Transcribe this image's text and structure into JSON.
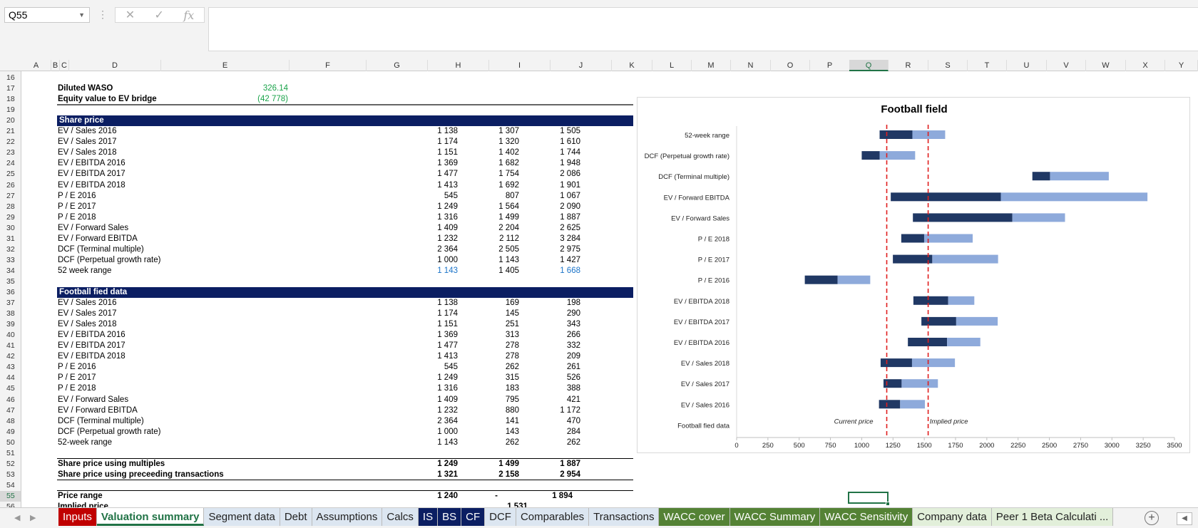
{
  "name_box": "Q55",
  "formula_bar": {
    "fx_label": "fx",
    "cancel_icon": "✕",
    "enter_icon": "✓",
    "value": ""
  },
  "columns": [
    "A",
    "B",
    "C",
    "D",
    "E",
    "F",
    "G",
    "H",
    "I",
    "J",
    "K",
    "L",
    "M",
    "N",
    "O",
    "P",
    "Q",
    "R",
    "S",
    "T",
    "U",
    "V",
    "W",
    "X",
    "Y"
  ],
  "selected_column": "Q",
  "rows": [
    16,
    17,
    18,
    19,
    20,
    21,
    22,
    23,
    24,
    25,
    26,
    27,
    28,
    29,
    30,
    31,
    32,
    33,
    34,
    35,
    36,
    37,
    38,
    39,
    40,
    41,
    42,
    43,
    44,
    45,
    46,
    47,
    48,
    49,
    50,
    51,
    52,
    53,
    54,
    55,
    56
  ],
  "selected_row": 55,
  "top": {
    "diluted_waso_label": "Diluted WASO",
    "diluted_waso_value": "326.14",
    "bridge_label": "Equity value to EV bridge",
    "bridge_value": "(42 778)"
  },
  "share_price": {
    "header": "Share price",
    "rows": [
      {
        "label": "EV / Sales 2016",
        "h": "1 138",
        "i": "1 307",
        "j": "1 505"
      },
      {
        "label": "EV / Sales 2017",
        "h": "1 174",
        "i": "1 320",
        "j": "1 610"
      },
      {
        "label": "EV / Sales 2018",
        "h": "1 151",
        "i": "1 402",
        "j": "1 744"
      },
      {
        "label": "EV / EBITDA 2016",
        "h": "1 369",
        "i": "1 682",
        "j": "1 948"
      },
      {
        "label": "EV / EBITDA 2017",
        "h": "1 477",
        "i": "1 754",
        "j": "2 086"
      },
      {
        "label": "EV / EBITDA 2018",
        "h": "1 413",
        "i": "1 692",
        "j": "1 901"
      },
      {
        "label": "P / E 2016",
        "h": "545",
        "i": "807",
        "j": "1 067"
      },
      {
        "label": "P / E 2017",
        "h": "1 249",
        "i": "1 564",
        "j": "2 090"
      },
      {
        "label": "P / E 2018",
        "h": "1 316",
        "i": "1 499",
        "j": "1 887"
      },
      {
        "label": "EV / Forward Sales",
        "h": "1 409",
        "i": "2 204",
        "j": "2 625"
      },
      {
        "label": "EV / Forward EBITDA",
        "h": "1 232",
        "i": "2 112",
        "j": "3 284"
      },
      {
        "label": "DCF (Terminal multiple)",
        "h": "2 364",
        "i": "2 505",
        "j": "2 975"
      },
      {
        "label": "DCF (Perpetual growth rate)",
        "h": "1 000",
        "i": "1 143",
        "j": "1 427"
      },
      {
        "label": "52 week range",
        "h": "1 143",
        "i": "1 405",
        "j": "1 668"
      }
    ]
  },
  "football_data": {
    "header": "Football fied data",
    "rows": [
      {
        "label": "EV / Sales 2016",
        "h": "1 138",
        "i": "169",
        "j": "198"
      },
      {
        "label": "EV / Sales 2017",
        "h": "1 174",
        "i": "145",
        "j": "290"
      },
      {
        "label": "EV / Sales 2018",
        "h": "1 151",
        "i": "251",
        "j": "343"
      },
      {
        "label": "EV / EBITDA 2016",
        "h": "1 369",
        "i": "313",
        "j": "266"
      },
      {
        "label": "EV / EBITDA 2017",
        "h": "1 477",
        "i": "278",
        "j": "332"
      },
      {
        "label": "EV / EBITDA 2018",
        "h": "1 413",
        "i": "278",
        "j": "209"
      },
      {
        "label": "P / E 2016",
        "h": "545",
        "i": "262",
        "j": "261"
      },
      {
        "label": "P / E 2017",
        "h": "1 249",
        "i": "315",
        "j": "526"
      },
      {
        "label": "P / E 2018",
        "h": "1 316",
        "i": "183",
        "j": "388"
      },
      {
        "label": "EV / Forward Sales",
        "h": "1 409",
        "i": "795",
        "j": "421"
      },
      {
        "label": "EV / Forward EBITDA",
        "h": "1 232",
        "i": "880",
        "j": "1 172"
      },
      {
        "label": "DCF (Terminal multiple)",
        "h": "2 364",
        "i": "141",
        "j": "470"
      },
      {
        "label": "DCF (Perpetual growth rate)",
        "h": "1 000",
        "i": "143",
        "j": "284"
      },
      {
        "label": "52-week range",
        "h": "1 143",
        "i": "262",
        "j": "262"
      }
    ]
  },
  "summary": {
    "multiples_label": "Share price using multiples",
    "multiples": {
      "h": "1 249",
      "i": "1 499",
      "j": "1 887"
    },
    "transactions_label": "Share price using preceeding transactions",
    "transactions": {
      "h": "1 321",
      "i": "2 158",
      "j": "2 954"
    },
    "price_range_label": "Price range",
    "price_range_low": "1 240",
    "price_range_sep": "-",
    "price_range_high": "1 894",
    "implied_price_label": "Implied price",
    "implied_price_value": "1 531"
  },
  "chart_data": {
    "type": "bar",
    "orientation": "horizontal-stacked",
    "title": "Football field",
    "categories": [
      "52-week range",
      "DCF (Perpetual growth rate)",
      "DCF (Terminal multiple)",
      "EV / Forward EBITDA",
      "EV / Forward Sales",
      "P / E 2018",
      "P / E 2017",
      "P / E 2016",
      "EV / EBITDA 2018",
      "EV / EBITDA 2017",
      "EV / EBITDA 2016",
      "EV / Sales 2018",
      "EV / Sales 2017",
      "EV / Sales 2016",
      "Football fied data"
    ],
    "series": [
      {
        "values": [
          1143,
          1000,
          2364,
          1232,
          1409,
          1316,
          1249,
          545,
          1413,
          1477,
          1369,
          1151,
          1174,
          1138,
          null
        ]
      },
      {
        "values": [
          262,
          143,
          141,
          880,
          795,
          183,
          315,
          262,
          278,
          278,
          313,
          251,
          145,
          169,
          null
        ]
      },
      {
        "values": [
          262,
          284,
          470,
          1172,
          421,
          388,
          526,
          261,
          209,
          332,
          266,
          343,
          290,
          198,
          null
        ]
      }
    ],
    "reference_lines": [
      {
        "label": "Current price",
        "value": 1200
      },
      {
        "label": "Implied price",
        "value": 1531
      }
    ],
    "xlim": [
      0,
      3500
    ],
    "xticks": [
      "0",
      "250",
      "500",
      "750",
      "1000",
      "1250",
      "1500",
      "1750",
      "2000",
      "2250",
      "2500",
      "2750",
      "3000",
      "3250",
      "3500"
    ],
    "colors": {
      "base": "none",
      "low": "#203864",
      "high": "#8eaadb",
      "reference": "#e01e1e"
    }
  },
  "sheet_tabs": [
    {
      "label": "Inputs",
      "bg": "#c00000",
      "fg": "#ffffff"
    },
    {
      "label": "Valuation summary",
      "bg": "#ffffff",
      "fg": "#217346",
      "active": true
    },
    {
      "label": "Segment data",
      "bg": "#dce6f1",
      "fg": "#222222"
    },
    {
      "label": "Debt",
      "bg": "#dce6f1",
      "fg": "#222222"
    },
    {
      "label": "Assumptions",
      "bg": "#dce6f1",
      "fg": "#222222"
    },
    {
      "label": "Calcs",
      "bg": "#dce6f1",
      "fg": "#222222"
    },
    {
      "label": "IS",
      "bg": "#0b1e62",
      "fg": "#ffffff"
    },
    {
      "label": "BS",
      "bg": "#0b1e62",
      "fg": "#ffffff"
    },
    {
      "label": "CF",
      "bg": "#0b1e62",
      "fg": "#ffffff"
    },
    {
      "label": "DCF",
      "bg": "#dce6f1",
      "fg": "#222222"
    },
    {
      "label": "Comparables",
      "bg": "#dce6f1",
      "fg": "#222222"
    },
    {
      "label": "Transactions",
      "bg": "#dce6f1",
      "fg": "#222222"
    },
    {
      "label": "WACC cover",
      "bg": "#548235",
      "fg": "#ffffff"
    },
    {
      "label": "WACC Summary",
      "bg": "#548235",
      "fg": "#ffffff"
    },
    {
      "label": "WACC Sensitivity",
      "bg": "#548235",
      "fg": "#ffffff"
    },
    {
      "label": "Company data",
      "bg": "#e2efda",
      "fg": "#222222"
    },
    {
      "label": "Peer 1 Beta Calculati ...",
      "bg": "#e2efda",
      "fg": "#222222"
    }
  ]
}
